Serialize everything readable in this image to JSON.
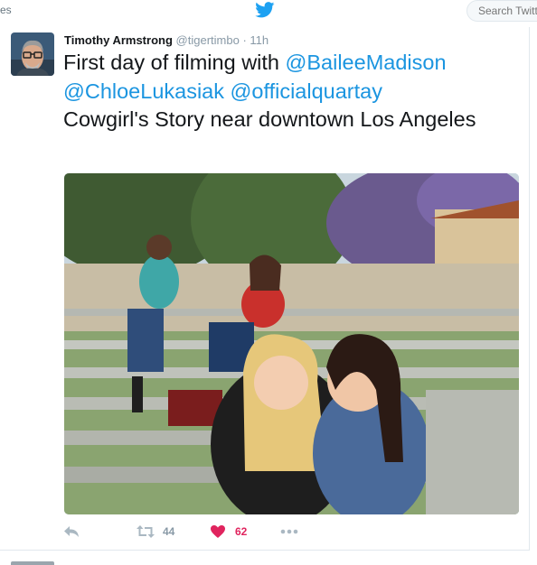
{
  "nav": {
    "left_fragment": "es"
  },
  "search": {
    "placeholder": "Search Twitter"
  },
  "tweet": {
    "author_name": "Timothy Armstrong",
    "handle": "@tigertimbo",
    "separator": "·",
    "time": "11h",
    "text_intro": "First day of filming with ",
    "mention_1": "@BaileeMadison",
    "mention_2": "@ChloeLukasiak",
    "mention_3": "@officialquartay",
    "text_rest": "Cowgirl's Story near downtown Los Angeles",
    "retweet_count": "44",
    "like_count": "62"
  },
  "colors": {
    "twitter_blue": "#1da1f2",
    "link": "#1b95e0",
    "like": "#e0245e",
    "muted": "#8899a6"
  },
  "icons": {
    "brand": "twitter-bird-icon",
    "reply": "reply-icon",
    "retweet": "retweet-icon",
    "like": "heart-icon",
    "more": "more-icon"
  }
}
